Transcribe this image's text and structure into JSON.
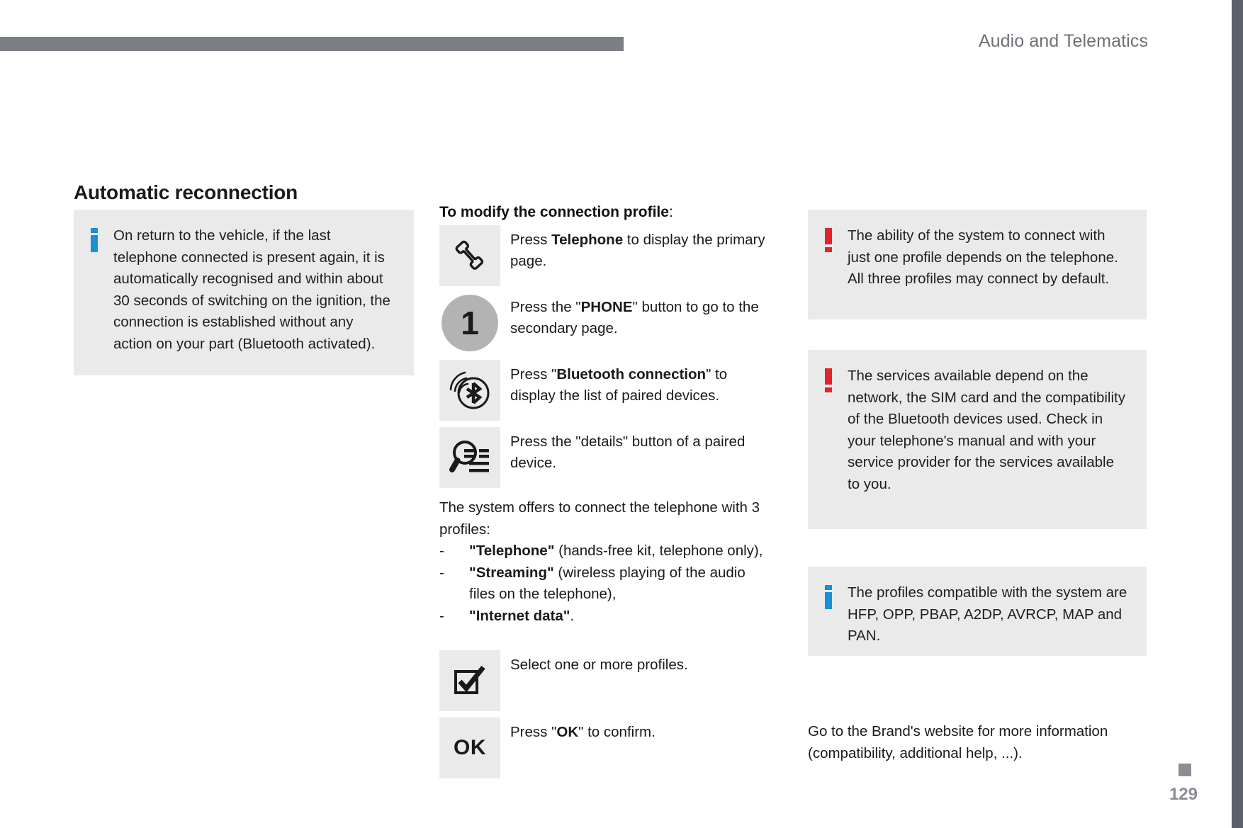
{
  "header": {
    "title": "Audio and Telematics"
  },
  "section": {
    "title": "Automatic reconnection"
  },
  "left_note": {
    "icon": "info-icon",
    "text": "On return to the vehicle, if the last telephone connected is present again, it is automatically recognised and within about 30 seconds of switching on the ignition, the connection is established without any action on your part (Bluetooth activated)."
  },
  "middle": {
    "heading_bold": "To modify the connection profile",
    "heading_plain": ":",
    "steps": [
      {
        "icon": "telephone-handset-icon",
        "text_parts": [
          {
            "text": "Press ",
            "bold": false
          },
          {
            "text": "Telephone",
            "bold": true
          },
          {
            "text": " to display the primary page.",
            "bold": false
          }
        ]
      },
      {
        "icon": "number-one-circle-icon",
        "icon_label": "1",
        "text_parts": [
          {
            "text": "Press the \"",
            "bold": false
          },
          {
            "text": "PHONE",
            "bold": true
          },
          {
            "text": "\" button to go to the secondary page.",
            "bold": false
          }
        ]
      },
      {
        "icon": "bluetooth-connection-icon",
        "text_parts": [
          {
            "text": "Press \"",
            "bold": false
          },
          {
            "text": "Bluetooth connection",
            "bold": true
          },
          {
            "text": "\" to display the list of paired devices.",
            "bold": false
          }
        ]
      },
      {
        "icon": "details-magnifier-icon",
        "text_parts": [
          {
            "text": "Press the \"details\" button of a paired device.",
            "bold": false
          }
        ]
      },
      {
        "icon": "checkbox-checked-icon",
        "text_parts": [
          {
            "text": "Select one or more profiles.",
            "bold": false
          }
        ]
      },
      {
        "icon": "ok-button-icon",
        "icon_label": "OK",
        "text_parts": [
          {
            "text": "Press \"",
            "bold": false
          },
          {
            "text": "OK",
            "bold": true
          },
          {
            "text": "\" to confirm.",
            "bold": false
          }
        ]
      }
    ],
    "profiles_intro": "The system offers to connect the telephone with 3 profiles:",
    "bullet_dash": "-",
    "profiles": [
      {
        "name": "\"Telephone\"",
        "desc": " (hands-free kit, telephone only),"
      },
      {
        "name": "\"Streaming\"",
        "desc": " (wireless playing of the audio files on the telephone),"
      },
      {
        "name": "\"Internet data\"",
        "desc": "."
      }
    ]
  },
  "right": {
    "warning_1": {
      "icon": "warning-exclamation-icon",
      "text": "The ability of the system to connect with just one profile depends on the telephone. All three profiles may connect by default."
    },
    "warning_2": {
      "icon": "warning-exclamation-icon",
      "text": "The services available depend on the network, the SIM card and the compatibility of the Bluetooth devices used. Check in your telephone's manual and with your service provider for the services available to you."
    },
    "note": {
      "icon": "info-icon",
      "text": "The profiles compatible with the system are HFP, OPP, PBAP, A2DP, AVRCP, MAP and PAN."
    },
    "closing": "Go to the Brand's website for more information (compatibility, additional help, ...)."
  },
  "footer": {
    "page_number": "129"
  },
  "colors": {
    "header_bar": "#7c7f85",
    "edge_bar": "#5c6068",
    "note_bg": "#eaeaea",
    "info_blue": "#1a8fd1",
    "warning_red": "#e3242b",
    "page_number": "#8b8e94"
  }
}
